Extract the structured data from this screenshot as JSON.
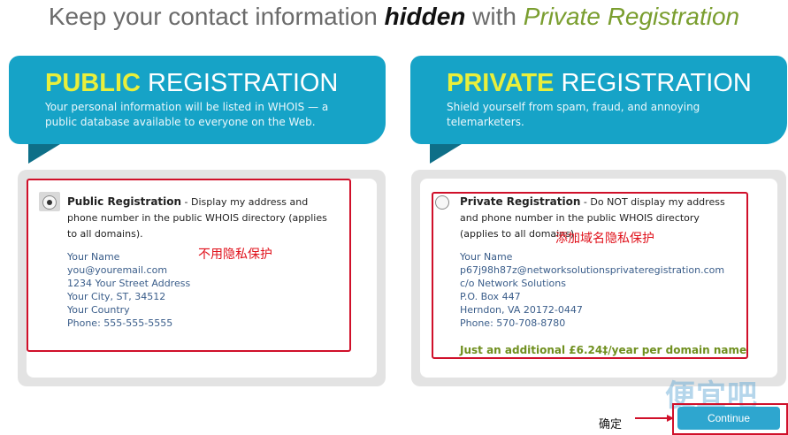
{
  "headline": {
    "part1": "Keep your contact information ",
    "hidden": "hidden",
    "part2": " with ",
    "private_reg": "Private Registration"
  },
  "public": {
    "title_keyword": "PUBLIC",
    "title_rest": " REGISTRATION",
    "description": "Your personal information will be listed in WHOIS — a public database available to everyone on the Web.",
    "option_name": "Public Registration",
    "option_desc": " - Display my address and phone number in the public WHOIS directory (applies to all domains).",
    "selected": true,
    "contact": [
      "Your Name",
      "you@youremail.com",
      "1234 Your Street Address",
      "Your City, ST, 34512",
      "Your Country",
      "Phone: 555-555-5555"
    ],
    "annotation": "不用隐私保护"
  },
  "private": {
    "title_keyword": "PRIVATE",
    "title_rest": " REGISTRATION",
    "description": "Shield yourself from spam, fraud, and annoying telemarketers.",
    "option_name": "Private Registration",
    "option_desc": " - Do NOT display my address and phone number in the public WHOIS directory (applies to all domains).",
    "selected": false,
    "contact": [
      "Your Name",
      "p67j98h87z@networksolutionsprivateregistration.com",
      "c/o Network Solutions",
      "P.O. Box 447",
      "Herndon, VA 20172-0447",
      "Phone: 570-708-8780"
    ],
    "price_note": "Just an additional £6.24‡/year per domain name",
    "annotation": "添加域名隐私保护"
  },
  "footer": {
    "confirm_annotation": "确定",
    "continue_label": "Continue",
    "watermark": "便宜吧"
  },
  "colors": {
    "banner": "#16a3c7",
    "keyword": "#e9ef3b",
    "annotation_red": "#d0102a",
    "price_green": "#6f8f1e",
    "contact_blue": "#3a5d8a"
  }
}
